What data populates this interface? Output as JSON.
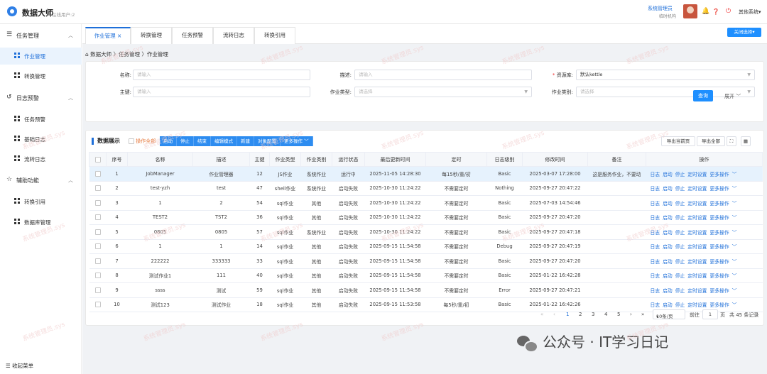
{
  "header": {
    "app_title": "数据大师",
    "online_users": "在线用户:2",
    "user_name": "系统管理员",
    "user_org": "临时机构",
    "other_systems": "其他系统▾",
    "icons": [
      "bell-icon",
      "help-icon",
      "power-icon"
    ]
  },
  "sidebar": {
    "groups": [
      {
        "label": "任务管理",
        "icon": "list-icon",
        "items": [
          {
            "label": "作业管理",
            "active": true
          },
          {
            "label": "转换管理"
          }
        ]
      },
      {
        "label": "日志预警",
        "icon": "history-icon",
        "items": [
          {
            "label": "任务预警"
          },
          {
            "label": "基础日志"
          },
          {
            "label": "流转日志"
          }
        ]
      },
      {
        "label": "辅助功能",
        "icon": "star-icon",
        "items": [
          {
            "label": "转换引用"
          },
          {
            "label": "数据库管理"
          }
        ]
      }
    ],
    "collapse_label": "收起菜单"
  },
  "tabs": [
    "作业管理",
    "转换管理",
    "任务预警",
    "流转日志",
    "转换引用"
  ],
  "close_all_label": "关闭选择",
  "breadcrumb": "数据大师 〉任务管理 〉作业管理",
  "search": {
    "name_label": "名称:",
    "name_placeholder": "请输入",
    "desc_label": "描述:",
    "desc_placeholder": "请输入",
    "repo_label": "资源库:",
    "repo_value": "默认kettle",
    "pk_label": "主键:",
    "pk_placeholder": "请输入",
    "jobtype_label": "作业类型:",
    "jobtype_placeholder": "请选择",
    "jobcat_label": "作业类别:",
    "jobcat_placeholder": "请选择",
    "query_label": "查询",
    "expand_label": "展开"
  },
  "data": {
    "title": "数据展示",
    "operate_all": "操作全部",
    "toolbar": [
      "启动",
      "停止",
      "结束",
      "编辑模式",
      "新建",
      "对象配置",
      "更多操作"
    ],
    "export_page": "导出当前页",
    "export_all": "导出全部",
    "columns": [
      "",
      "序号",
      "名称",
      "描述",
      "主键",
      "作业类型",
      "作业类别",
      "运行状态",
      "最后更新时间",
      "定时",
      "日志级别",
      "修改时间",
      "备注",
      "操作"
    ],
    "rows": [
      [
        "1",
        "JobManager",
        "作业管理器",
        "12",
        "JS作业",
        "系统作业",
        "运行中",
        "2025-11-05 14:28:30",
        "每15秒/重/初",
        "Basic",
        "2025-03-07 17:28:00",
        "这是服务作业，不要动"
      ],
      [
        "2",
        "test-yzh",
        "test",
        "47",
        "shell作业",
        "系统作业",
        "启动失败",
        "2025-10-30 11:24:22",
        "不需要定时",
        "Nothing",
        "2025-09-27 20:47:22",
        ""
      ],
      [
        "3",
        "1",
        "2",
        "54",
        "sql作业",
        "其他",
        "启动失败",
        "2025-10-30 11:24:22",
        "不需要定时",
        "Basic",
        "2025-07-03 14:54:46",
        ""
      ],
      [
        "4",
        "TEST2",
        "TST2",
        "36",
        "sql作业",
        "其他",
        "启动失败",
        "2025-10-30 11:24:22",
        "不需要定时",
        "Basic",
        "2025-09-27 20:47:20",
        ""
      ],
      [
        "5",
        "0805",
        "0805",
        "57",
        "sql作业",
        "系统作业",
        "启动失败",
        "2025-10-30 11:24:22",
        "不需要定时",
        "Basic",
        "2025-09-27 20:47:18",
        ""
      ],
      [
        "6",
        "1",
        "1",
        "14",
        "sql作业",
        "其他",
        "启动失败",
        "2025-09-15 11:54:58",
        "不需要定时",
        "Debug",
        "2025-09-27 20:47:19",
        ""
      ],
      [
        "7",
        "222222",
        "333333",
        "33",
        "sql作业",
        "其他",
        "启动失败",
        "2025-09-15 11:54:58",
        "不需要定时",
        "Basic",
        "2025-09-27 20:47:20",
        ""
      ],
      [
        "8",
        "测试作业1",
        "111",
        "40",
        "sql作业",
        "其他",
        "启动失败",
        "2025-09-15 11:54:58",
        "不需要定时",
        "Basic",
        "2025-01-22 16:42:28",
        ""
      ],
      [
        "9",
        "ssss",
        "测试",
        "59",
        "sql作业",
        "其他",
        "启动失败",
        "2025-09-15 11:54:58",
        "不需要定时",
        "Error",
        "2025-09-27 20:47:21",
        ""
      ],
      [
        "10",
        "测试123",
        "测试作业",
        "18",
        "sql作业",
        "其他",
        "启动失败",
        "2025-09-15 11:53:58",
        "每5秒/重/初",
        "Basic",
        "2025-01-22 16:42:26",
        ""
      ]
    ],
    "row_actions": [
      "日志",
      "启动",
      "停止",
      "定时设置",
      "更多操作"
    ]
  },
  "pagination": {
    "pages": [
      "1",
      "2",
      "3",
      "4",
      "5"
    ],
    "page_size": "10条/页",
    "goto_label": "前往",
    "goto_value": "1",
    "page_unit": "页",
    "total": "共 45 条记录"
  },
  "watermark": "系统管理员.sys",
  "footer_brand": "公众号 · IT学习日记",
  "colors": {
    "accent": "#1e8fff",
    "link": "#1e6fd9",
    "warn": "#e6783c"
  }
}
